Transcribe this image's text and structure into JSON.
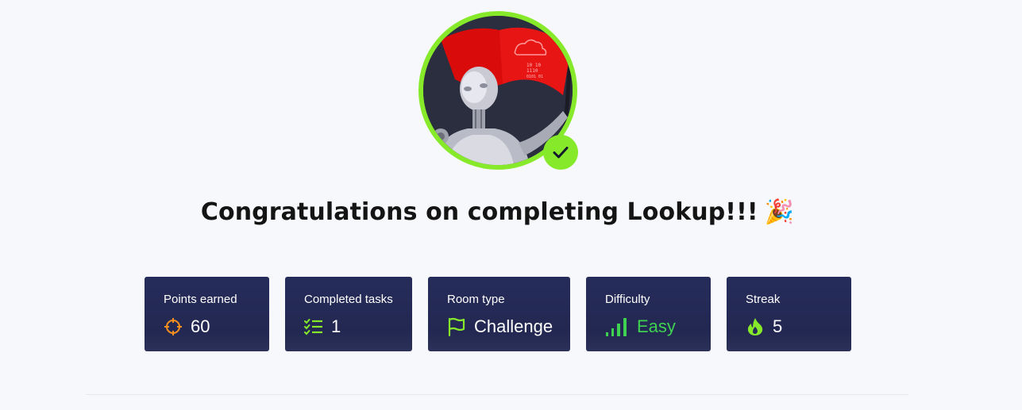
{
  "completion": {
    "title": "Congratulations on completing Lookup!!!",
    "celebration_emoji": "🎉",
    "avatar_icon": "robot-flag-avatar",
    "badge_icon": "checkmark-icon"
  },
  "colors": {
    "accent_green": "#86ea2a",
    "card_bg": "#232852",
    "points_orange": "#f7901e",
    "easy_green": "#3fd251",
    "flag_red": "#d90b0b"
  },
  "stats": [
    {
      "label": "Points earned",
      "value": "60",
      "icon": "crosshair-icon"
    },
    {
      "label": "Completed tasks",
      "value": "1",
      "icon": "checklist-icon"
    },
    {
      "label": "Room type",
      "value": "Challenge",
      "icon": "flag-icon"
    },
    {
      "label": "Difficulty",
      "value": "Easy",
      "icon": "signal-bars-icon"
    },
    {
      "label": "Streak",
      "value": "5",
      "icon": "flame-icon"
    }
  ]
}
